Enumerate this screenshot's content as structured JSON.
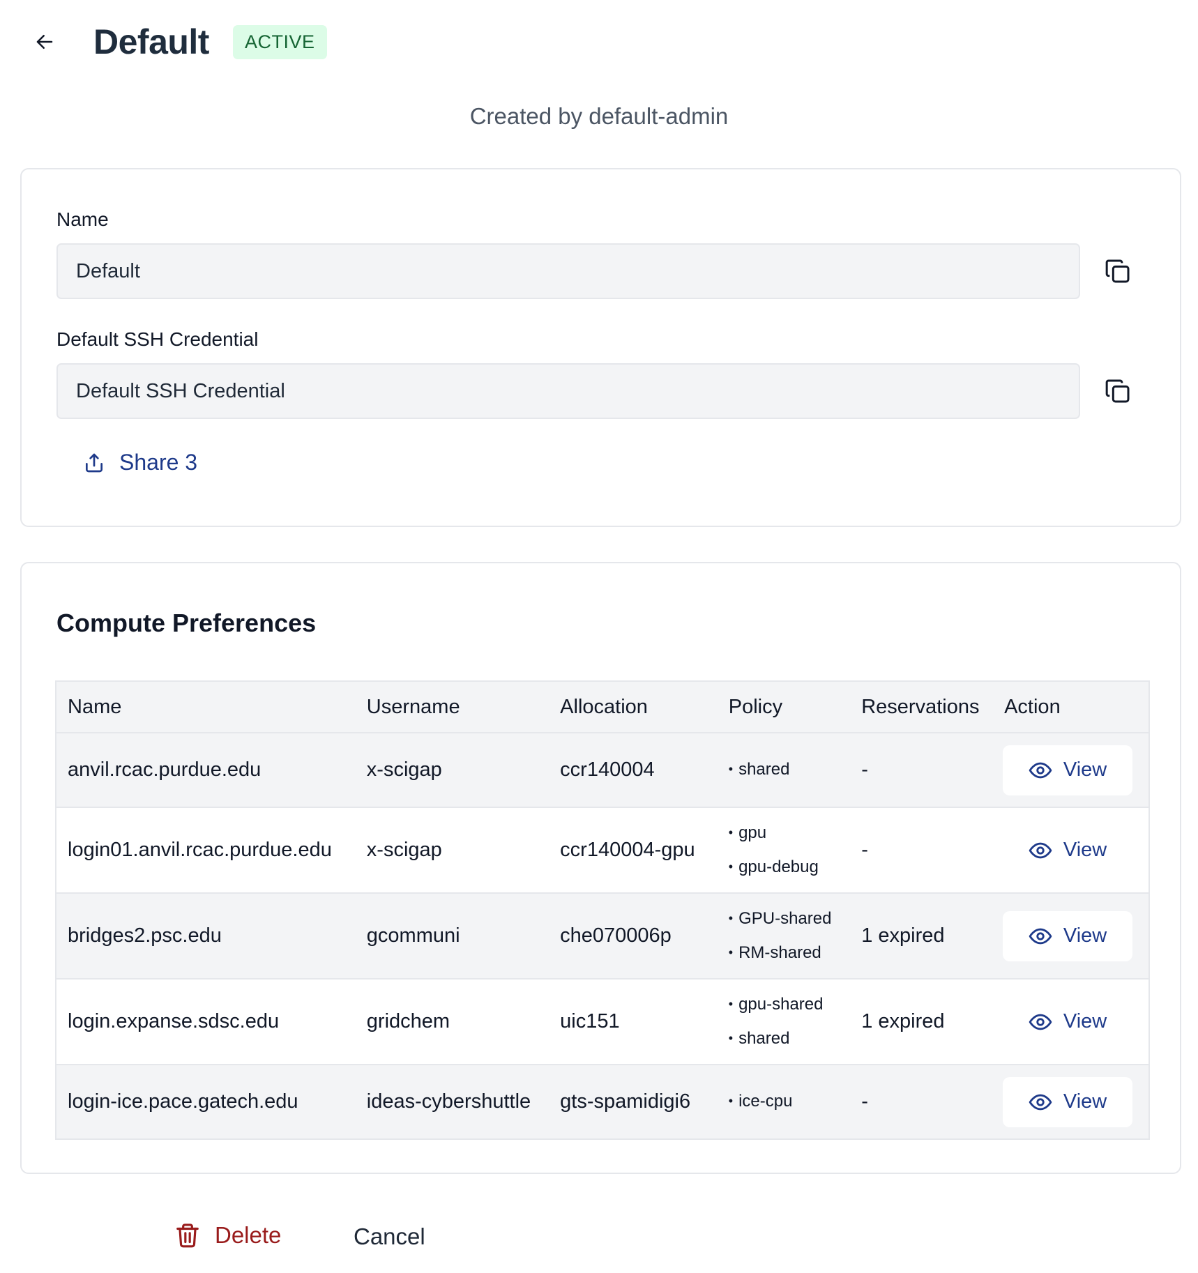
{
  "header": {
    "title": "Default",
    "status": "ACTIVE",
    "created_by": "Created by default-admin"
  },
  "general": {
    "name_label": "Name",
    "name_value": "Default",
    "ssh_label": "Default SSH Credential",
    "ssh_value": "Default SSH Credential",
    "share_label": "Share 3"
  },
  "compute": {
    "title": "Compute Preferences",
    "columns": [
      "Name",
      "Username",
      "Allocation",
      "Policy",
      "Reservations",
      "Action"
    ],
    "rows": [
      {
        "name": "anvil.rcac.purdue.edu",
        "username": "x-scigap",
        "allocation": "ccr140004",
        "policies": [
          "shared"
        ],
        "reservations": "-",
        "action": "View"
      },
      {
        "name": "login01.anvil.rcac.purdue.edu",
        "username": "x-scigap",
        "allocation": "ccr140004-gpu",
        "policies": [
          "gpu",
          "gpu-debug"
        ],
        "reservations": "-",
        "action": "View"
      },
      {
        "name": "bridges2.psc.edu",
        "username": "gcommuni",
        "allocation": "che070006p",
        "policies": [
          "GPU-shared",
          "RM-shared"
        ],
        "reservations": "1 expired",
        "action": "View"
      },
      {
        "name": "login.expanse.sdsc.edu",
        "username": "gridchem",
        "allocation": "uic151",
        "policies": [
          "gpu-shared",
          "shared"
        ],
        "reservations": "1 expired",
        "action": "View"
      },
      {
        "name": "login-ice.pace.gatech.edu",
        "username": "ideas-cybershuttle",
        "allocation": "gts-spamidigi6",
        "policies": [
          "ice-cpu"
        ],
        "reservations": "-",
        "action": "View"
      }
    ]
  },
  "footer": {
    "delete_label": "Delete",
    "cancel_label": "Cancel"
  },
  "colors": {
    "link": "#1e3a8a",
    "danger": "#991b1b",
    "expired": "#dc2626",
    "badge_bg": "#dcfce7",
    "badge_text": "#166534"
  },
  "icons": {
    "back": "arrow-left-icon",
    "copy": "copy-icon",
    "share": "share-icon",
    "view": "eye-icon",
    "delete": "trash-icon"
  }
}
